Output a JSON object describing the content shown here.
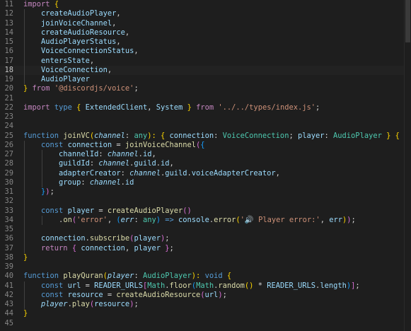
{
  "editor": {
    "current_line": 18,
    "theme": {
      "background": "#1e1e1e",
      "keyword_control": "#c586c0",
      "keyword": "#569cd6",
      "variable": "#9cdcfe",
      "function": "#dcdcaa",
      "type": "#4ec9b0",
      "string": "#ce9178",
      "bracket_1": "#ffd700",
      "bracket_2": "#da70d6",
      "bracket_3": "#179fff"
    },
    "lines": [
      {
        "n": "11",
        "guides": 0,
        "tokens": [
          [
            "import",
            "k"
          ],
          [
            " ",
            "p"
          ],
          [
            "{",
            "b1"
          ]
        ]
      },
      {
        "n": "12",
        "guides": 1,
        "tokens": [
          [
            "    createAudioPlayer",
            "v"
          ],
          [
            ",",
            "p"
          ]
        ]
      },
      {
        "n": "13",
        "guides": 1,
        "tokens": [
          [
            "    joinVoiceChannel",
            "v"
          ],
          [
            ",",
            "p"
          ]
        ]
      },
      {
        "n": "14",
        "guides": 1,
        "tokens": [
          [
            "    createAudioResource",
            "v"
          ],
          [
            ",",
            "p"
          ]
        ]
      },
      {
        "n": "15",
        "guides": 1,
        "tokens": [
          [
            "    AudioPlayerStatus",
            "v"
          ],
          [
            ",",
            "p"
          ]
        ]
      },
      {
        "n": "16",
        "guides": 1,
        "tokens": [
          [
            "    VoiceConnectionStatus",
            "v"
          ],
          [
            ",",
            "p"
          ]
        ]
      },
      {
        "n": "17",
        "guides": 1,
        "tokens": [
          [
            "    entersState",
            "v"
          ],
          [
            ",",
            "p"
          ]
        ]
      },
      {
        "n": "18",
        "guides": 1,
        "tokens": [
          [
            "    VoiceConnection",
            "v"
          ],
          [
            ",",
            "p"
          ]
        ]
      },
      {
        "n": "19",
        "guides": 1,
        "tokens": [
          [
            "    AudioPlayer",
            "v"
          ]
        ]
      },
      {
        "n": "20",
        "guides": 0,
        "tokens": [
          [
            "}",
            "b1"
          ],
          [
            " ",
            "p"
          ],
          [
            "from",
            "k"
          ],
          [
            " ",
            "p"
          ],
          [
            "'@discordjs/voice'",
            "s"
          ],
          [
            ";",
            "p"
          ]
        ]
      },
      {
        "n": "21",
        "guides": 0,
        "tokens": []
      },
      {
        "n": "22",
        "guides": 0,
        "tokens": [
          [
            "import",
            "k"
          ],
          [
            " ",
            "p"
          ],
          [
            "type",
            "kw"
          ],
          [
            " ",
            "p"
          ],
          [
            "{",
            "b1"
          ],
          [
            " ",
            "p"
          ],
          [
            "ExtendedClient",
            "v"
          ],
          [
            ", ",
            "p"
          ],
          [
            "System",
            "v"
          ],
          [
            " ",
            "p"
          ],
          [
            "}",
            "b1"
          ],
          [
            " ",
            "p"
          ],
          [
            "from",
            "k"
          ],
          [
            " ",
            "p"
          ],
          [
            "'../../types/index.js'",
            "s"
          ],
          [
            ";",
            "p"
          ]
        ]
      },
      {
        "n": "23",
        "guides": 0,
        "tokens": []
      },
      {
        "n": "24",
        "guides": 0,
        "tokens": []
      },
      {
        "n": "25",
        "guides": 0,
        "tokens": [
          [
            "function",
            "kw"
          ],
          [
            " ",
            "p"
          ],
          [
            "joinVC",
            "f"
          ],
          [
            "(",
            "b1"
          ],
          [
            "channel",
            "v it"
          ],
          [
            ": ",
            "p"
          ],
          [
            "any",
            "t"
          ],
          [
            "): ",
            "b1"
          ],
          [
            "{",
            "b1"
          ],
          [
            " ",
            "p"
          ],
          [
            "connection",
            "v"
          ],
          [
            ": ",
            "p"
          ],
          [
            "VoiceConnection",
            "t"
          ],
          [
            "; ",
            "p"
          ],
          [
            "player",
            "v"
          ],
          [
            ": ",
            "p"
          ],
          [
            "AudioPlayer",
            "t"
          ],
          [
            " ",
            "p"
          ],
          [
            "}",
            "b1"
          ],
          [
            " ",
            "p"
          ],
          [
            "{",
            "b1"
          ]
        ]
      },
      {
        "n": "26",
        "guides": 1,
        "tokens": [
          [
            "    ",
            "p"
          ],
          [
            "const",
            "kw"
          ],
          [
            " ",
            "p"
          ],
          [
            "connection",
            "v"
          ],
          [
            " = ",
            "p"
          ],
          [
            "joinVoiceChannel",
            "f"
          ],
          [
            "(",
            "b2"
          ],
          [
            "{",
            "b3"
          ]
        ]
      },
      {
        "n": "27",
        "guides": 2,
        "tokens": [
          [
            "        ",
            "p"
          ],
          [
            "channelId",
            "v"
          ],
          [
            ": ",
            "p"
          ],
          [
            "channel",
            "v it"
          ],
          [
            ".",
            "p"
          ],
          [
            "id",
            "v"
          ],
          [
            ",",
            "p"
          ]
        ]
      },
      {
        "n": "28",
        "guides": 2,
        "tokens": [
          [
            "        ",
            "p"
          ],
          [
            "guildId",
            "v"
          ],
          [
            ": ",
            "p"
          ],
          [
            "channel",
            "v it"
          ],
          [
            ".",
            "p"
          ],
          [
            "guild",
            "v"
          ],
          [
            ".",
            "p"
          ],
          [
            "id",
            "v"
          ],
          [
            ",",
            "p"
          ]
        ]
      },
      {
        "n": "29",
        "guides": 2,
        "tokens": [
          [
            "        ",
            "p"
          ],
          [
            "adapterCreator",
            "v"
          ],
          [
            ": ",
            "p"
          ],
          [
            "channel",
            "v it"
          ],
          [
            ".",
            "p"
          ],
          [
            "guild",
            "v"
          ],
          [
            ".",
            "p"
          ],
          [
            "voiceAdapterCreator",
            "v"
          ],
          [
            ",",
            "p"
          ]
        ]
      },
      {
        "n": "30",
        "guides": 2,
        "tokens": [
          [
            "        ",
            "p"
          ],
          [
            "group",
            "v"
          ],
          [
            ": ",
            "p"
          ],
          [
            "channel",
            "v it"
          ],
          [
            ".",
            "p"
          ],
          [
            "id",
            "v"
          ]
        ]
      },
      {
        "n": "31",
        "guides": 1,
        "tokens": [
          [
            "    ",
            "p"
          ],
          [
            "}",
            "b3"
          ],
          [
            ")",
            "b2"
          ],
          [
            ";",
            "p"
          ]
        ]
      },
      {
        "n": "32",
        "guides": 1,
        "tokens": []
      },
      {
        "n": "33",
        "guides": 1,
        "tokens": [
          [
            "    ",
            "p"
          ],
          [
            "const",
            "kw"
          ],
          [
            " ",
            "p"
          ],
          [
            "player",
            "v"
          ],
          [
            " = ",
            "p"
          ],
          [
            "createAudioPlayer",
            "f"
          ],
          [
            "()",
            "b2"
          ]
        ]
      },
      {
        "n": "34",
        "guides": 2,
        "tokens": [
          [
            "        .",
            "p"
          ],
          [
            "on",
            "f"
          ],
          [
            "(",
            "b2"
          ],
          [
            "'error'",
            "s"
          ],
          [
            ", ",
            "p"
          ],
          [
            "(",
            "b3"
          ],
          [
            "err",
            "v it"
          ],
          [
            ": ",
            "p"
          ],
          [
            "any",
            "t"
          ],
          [
            ")",
            "b3"
          ],
          [
            " => ",
            "kw"
          ],
          [
            "console",
            "v"
          ],
          [
            ".",
            "p"
          ],
          [
            "error",
            "f"
          ],
          [
            "(",
            "b1"
          ],
          [
            "'🔊 Player error:'",
            "s"
          ],
          [
            ", ",
            "p"
          ],
          [
            "err",
            "v"
          ],
          [
            ")",
            "b1"
          ],
          [
            ")",
            "b2"
          ],
          [
            ";",
            "p"
          ]
        ]
      },
      {
        "n": "35",
        "guides": 1,
        "tokens": []
      },
      {
        "n": "36",
        "guides": 1,
        "tokens": [
          [
            "    ",
            "p"
          ],
          [
            "connection",
            "v"
          ],
          [
            ".",
            "p"
          ],
          [
            "subscribe",
            "f"
          ],
          [
            "(",
            "b2"
          ],
          [
            "player",
            "v"
          ],
          [
            ")",
            "b2"
          ],
          [
            ";",
            "p"
          ]
        ]
      },
      {
        "n": "37",
        "guides": 1,
        "tokens": [
          [
            "    ",
            "p"
          ],
          [
            "return",
            "k"
          ],
          [
            " ",
            "p"
          ],
          [
            "{",
            "b2"
          ],
          [
            " ",
            "p"
          ],
          [
            "connection",
            "v"
          ],
          [
            ", ",
            "p"
          ],
          [
            "player",
            "v"
          ],
          [
            " ",
            "p"
          ],
          [
            "}",
            "b2"
          ],
          [
            ";",
            "p"
          ]
        ]
      },
      {
        "n": "38",
        "guides": 0,
        "tokens": [
          [
            "}",
            "b1"
          ]
        ]
      },
      {
        "n": "39",
        "guides": 0,
        "tokens": []
      },
      {
        "n": "40",
        "guides": 0,
        "tokens": [
          [
            "function",
            "kw"
          ],
          [
            " ",
            "p"
          ],
          [
            "playQuran",
            "f"
          ],
          [
            "(",
            "b1"
          ],
          [
            "player",
            "v it"
          ],
          [
            ": ",
            "p"
          ],
          [
            "AudioPlayer",
            "t"
          ],
          [
            "): ",
            "b1"
          ],
          [
            "void",
            "kw"
          ],
          [
            " ",
            "p"
          ],
          [
            "{",
            "b1"
          ]
        ]
      },
      {
        "n": "41",
        "guides": 1,
        "tokens": [
          [
            "    ",
            "p"
          ],
          [
            "const",
            "kw"
          ],
          [
            " ",
            "p"
          ],
          [
            "url",
            "v"
          ],
          [
            " = ",
            "p"
          ],
          [
            "READER_URLS",
            "v"
          ],
          [
            "[",
            "b2"
          ],
          [
            "Math",
            "t"
          ],
          [
            ".",
            "p"
          ],
          [
            "floor",
            "f"
          ],
          [
            "(",
            "b3"
          ],
          [
            "Math",
            "t"
          ],
          [
            ".",
            "p"
          ],
          [
            "random",
            "f"
          ],
          [
            "()",
            "b1"
          ],
          [
            " * ",
            "p"
          ],
          [
            "READER_URLS",
            "v"
          ],
          [
            ".",
            "p"
          ],
          [
            "length",
            "v"
          ],
          [
            ")",
            "b3"
          ],
          [
            "]",
            "b2"
          ],
          [
            ";",
            "p"
          ]
        ]
      },
      {
        "n": "42",
        "guides": 1,
        "tokens": [
          [
            "    ",
            "p"
          ],
          [
            "const",
            "kw"
          ],
          [
            " ",
            "p"
          ],
          [
            "resource",
            "v"
          ],
          [
            " = ",
            "p"
          ],
          [
            "createAudioResource",
            "f"
          ],
          [
            "(",
            "b2"
          ],
          [
            "url",
            "v"
          ],
          [
            ")",
            "b2"
          ],
          [
            ";",
            "p"
          ]
        ]
      },
      {
        "n": "43",
        "guides": 1,
        "tokens": [
          [
            "    ",
            "p"
          ],
          [
            "player",
            "v it"
          ],
          [
            ".",
            "p"
          ],
          [
            "play",
            "f"
          ],
          [
            "(",
            "b2"
          ],
          [
            "resource",
            "v"
          ],
          [
            ")",
            "b2"
          ],
          [
            ";",
            "p"
          ]
        ]
      },
      {
        "n": "44",
        "guides": 0,
        "tokens": [
          [
            "}",
            "b1"
          ]
        ]
      },
      {
        "n": "45",
        "guides": 0,
        "tokens": []
      }
    ]
  }
}
